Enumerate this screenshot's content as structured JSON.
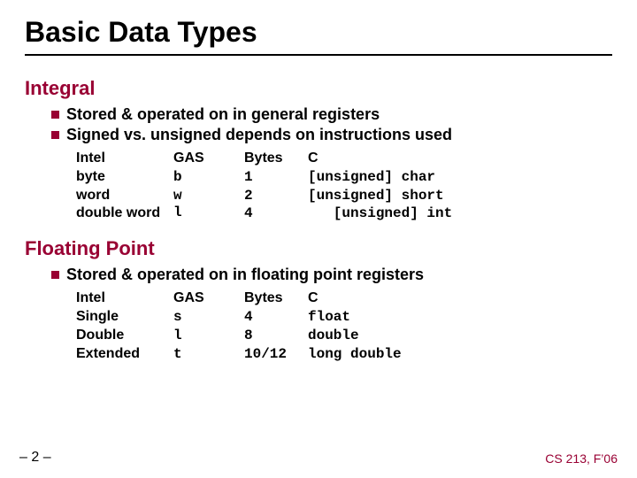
{
  "title": "Basic Data Types",
  "sections": {
    "integral": {
      "heading": "Integral",
      "bullets": [
        "Stored & operated on in general registers",
        "Signed vs. unsigned depends on instructions used"
      ],
      "table": {
        "headers": {
          "intel": "Intel",
          "gas": "GAS",
          "bytes": "Bytes",
          "c": "C"
        },
        "rows": [
          {
            "intel": "byte",
            "gas": "b",
            "bytes": "1",
            "c": "[unsigned] char"
          },
          {
            "intel": "word",
            "gas": "w",
            "bytes": "2",
            "c": "[unsigned] short"
          },
          {
            "intel": "double word",
            "gas": "l",
            "bytes": "4",
            "c": "   [unsigned] int"
          }
        ]
      }
    },
    "floating": {
      "heading": "Floating Point",
      "bullets": [
        "Stored & operated on in floating point registers"
      ],
      "table": {
        "headers": {
          "intel": "Intel",
          "gas": "GAS",
          "bytes": "Bytes",
          "c": "C"
        },
        "rows": [
          {
            "intel": "Single",
            "gas": "s",
            "bytes": "4",
            "c": "float"
          },
          {
            "intel": "Double",
            "gas": "l",
            "bytes": "8",
            "c": "double"
          },
          {
            "intel": "Extended",
            "gas": "t",
            "bytes": "10/12",
            "c": "long double"
          }
        ]
      }
    }
  },
  "footer": {
    "left": "– 2 –",
    "right": "CS 213, F’06"
  }
}
